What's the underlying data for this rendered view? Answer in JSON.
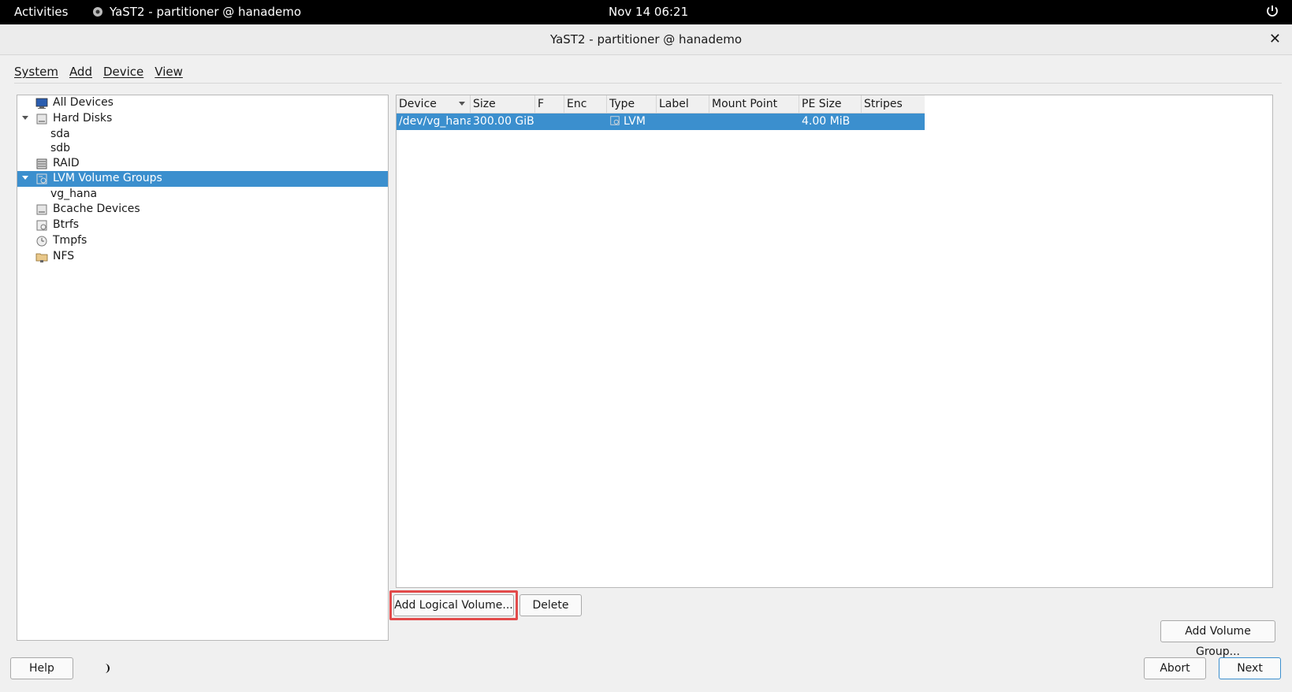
{
  "topbar": {
    "activities": "Activities",
    "app_name": "YaST2 - partitioner @ hanademo",
    "clock": "Nov 14  06:21"
  },
  "window": {
    "title": "YaST2 - partitioner @ hanademo"
  },
  "menu": {
    "system": "System",
    "add": "Add",
    "device": "Device",
    "view": "View"
  },
  "tree": {
    "items": [
      {
        "label": "All Devices",
        "icon": "monitor-icon"
      },
      {
        "label": "Hard Disks",
        "icon": "hard-disk-icon"
      },
      {
        "label": "sda"
      },
      {
        "label": "sdb"
      },
      {
        "label": "RAID",
        "icon": "raid-icon"
      },
      {
        "label": "LVM Volume Groups",
        "icon": "lvm-icon",
        "selected": true
      },
      {
        "label": "vg_hana"
      },
      {
        "label": "Bcache Devices",
        "icon": "bcache-icon"
      },
      {
        "label": "Btrfs",
        "icon": "btrfs-icon"
      },
      {
        "label": "Tmpfs",
        "icon": "tmpfs-icon"
      },
      {
        "label": "NFS",
        "icon": "nfs-icon"
      }
    ]
  },
  "table": {
    "columns": [
      "Device",
      "Size",
      "F",
      "Enc",
      "Type",
      "Label",
      "Mount Point",
      "PE Size",
      "Stripes"
    ],
    "rows": [
      {
        "device": "/dev/vg_hana",
        "size": "300.00 GiB",
        "f": "",
        "enc": "",
        "type": "LVM",
        "type_icon": "lvm-icon",
        "label": "",
        "mount_point": "",
        "pe_size": "4.00 MiB",
        "stripes": ""
      }
    ]
  },
  "buttons": {
    "add_logical_volume": "Add Logical Volume...",
    "delete": "Delete",
    "add_volume_group": "Add Volume Group...",
    "help": "Help",
    "abort": "Abort",
    "next": "Next"
  },
  "colors": {
    "selection": "#3b8fce",
    "highlight": "#e24a4a",
    "topbar": "#000000"
  }
}
